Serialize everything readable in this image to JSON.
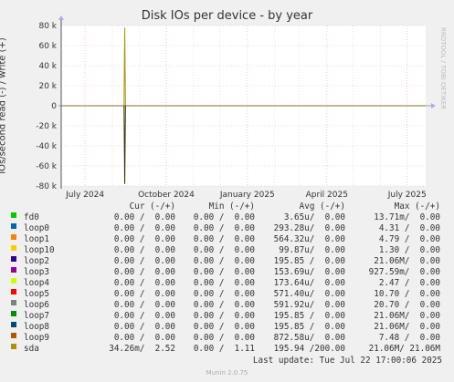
{
  "chart_data": {
    "type": "line",
    "title": "Disk IOs per device - by year",
    "ylabel": "IOs/second read (-) / write (+)",
    "ylim": [
      -80000,
      80000
    ],
    "yticks": [
      {
        "value": 80000,
        "label": "80 k"
      },
      {
        "value": 60000,
        "label": "60 k"
      },
      {
        "value": 40000,
        "label": "40 k"
      },
      {
        "value": 20000,
        "label": "20 k"
      },
      {
        "value": 0,
        "label": "0"
      },
      {
        "value": -20000,
        "label": "-20 k"
      },
      {
        "value": -40000,
        "label": "-40 k"
      },
      {
        "value": -60000,
        "label": "-60 k"
      },
      {
        "value": -80000,
        "label": "-80 k"
      }
    ],
    "xlim": [
      "2024-06-04",
      "2025-07-22"
    ],
    "xticks": [
      {
        "date": "2024-07-01",
        "label": "July 2024"
      },
      {
        "date": "2024-10-01",
        "label": "October 2024"
      },
      {
        "date": "2025-01-01",
        "label": "January 2025"
      },
      {
        "date": "2025-04-01",
        "label": "April 2025"
      },
      {
        "date": "2025-07-01",
        "label": "July 2025"
      }
    ],
    "grid": true,
    "spike": {
      "date": "2024-08-15",
      "write": 78000,
      "read": -78000
    },
    "series": [
      {
        "name": "fd0",
        "color": "#00cc00",
        "cur": "0.00 /  0.00",
        "min": "0.00 /  0.00",
        "avg": "3.65u/  0.00",
        "max": "13.71m/  0.00"
      },
      {
        "name": "loop0",
        "color": "#0066b3",
        "cur": "0.00 /  0.00",
        "min": "0.00 /  0.00",
        "avg": "293.28u/  0.00",
        "max": "4.31 /  0.00"
      },
      {
        "name": "loop1",
        "color": "#ff8000",
        "cur": "0.00 /  0.00",
        "min": "0.00 /  0.00",
        "avg": "564.32u/  0.00",
        "max": "4.79 /  0.00"
      },
      {
        "name": "loop10",
        "color": "#ffcc00",
        "cur": "0.00 /  0.00",
        "min": "0.00 /  0.00",
        "avg": "99.87u/  0.00",
        "max": "1.30 /  0.00"
      },
      {
        "name": "loop2",
        "color": "#330099",
        "cur": "0.00 /  0.00",
        "min": "0.00 /  0.00",
        "avg": "195.85 /  0.00",
        "max": "21.06M/  0.00"
      },
      {
        "name": "loop3",
        "color": "#990099",
        "cur": "0.00 /  0.00",
        "min": "0.00 /  0.00",
        "avg": "153.69u/  0.00",
        "max": "927.59m/  0.00"
      },
      {
        "name": "loop4",
        "color": "#ccff00",
        "cur": "0.00 /  0.00",
        "min": "0.00 /  0.00",
        "avg": "173.64u/  0.00",
        "max": "2.47 /  0.00"
      },
      {
        "name": "loop5",
        "color": "#ff0000",
        "cur": "0.00 /  0.00",
        "min": "0.00 /  0.00",
        "avg": "571.40u/  0.00",
        "max": "10.70 /  0.00"
      },
      {
        "name": "loop6",
        "color": "#808080",
        "cur": "0.00 /  0.00",
        "min": "0.00 /  0.00",
        "avg": "591.92u/  0.00",
        "max": "20.70 /  0.00"
      },
      {
        "name": "loop7",
        "color": "#008f00",
        "cur": "0.00 /  0.00",
        "min": "0.00 /  0.00",
        "avg": "195.85 /  0.00",
        "max": "21.06M/  0.00"
      },
      {
        "name": "loop8",
        "color": "#00487d",
        "cur": "0.00 /  0.00",
        "min": "0.00 /  0.00",
        "avg": "195.85 /  0.00",
        "max": "21.06M/  0.00"
      },
      {
        "name": "loop9",
        "color": "#b35a00",
        "cur": "0.00 /  0.00",
        "min": "0.00 /  0.00",
        "avg": "872.58u/  0.00",
        "max": "7.48 /  0.00"
      },
      {
        "name": "sda",
        "color": "#b38f00",
        "cur": "34.26m/  2.52",
        "min": "0.00 /  1.11",
        "avg": "195.94 /200.00",
        "max": "21.06M/ 21.06M"
      }
    ]
  },
  "legend_headers": {
    "cur": "Cur (-/+)",
    "min": "Min (-/+)",
    "avg": "Avg (-/+)",
    "max": "Max (-/+)"
  },
  "last_update": "Last update: Tue Jul 22 17:00:06 2025",
  "side_text": "RRDTOOL / TOBI OETIKER",
  "footer": "Munin 2.0.75"
}
